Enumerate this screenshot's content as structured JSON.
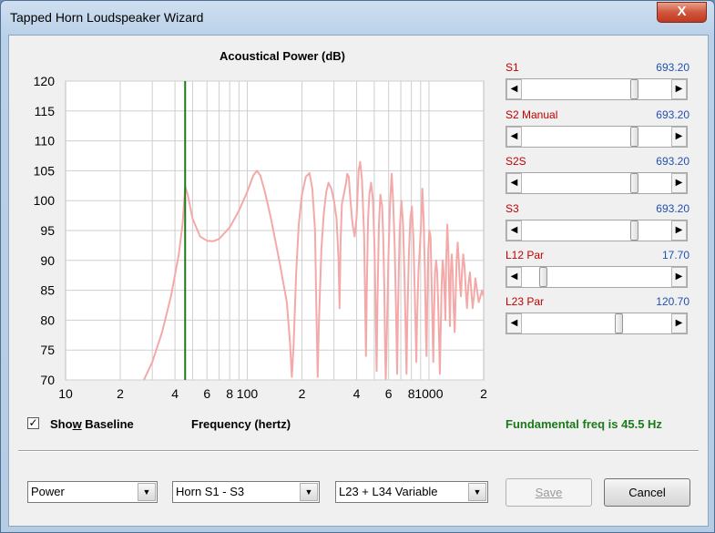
{
  "window": {
    "title": "Tapped Horn Loudspeaker Wizard",
    "close_glyph": "X"
  },
  "chart_data": {
    "type": "line",
    "title": "Acoustical Power (dB)",
    "xlabel": "Frequency (hertz)",
    "ylabel": "",
    "x_scale": "log",
    "xlim": [
      10,
      2000
    ],
    "ylim": [
      70,
      120
    ],
    "grid": true,
    "y_ticks": [
      "120",
      "115",
      "110",
      "105",
      "100",
      "95",
      "90",
      "85",
      "80",
      "75",
      "70"
    ],
    "x_ticks": [
      {
        "value": 10,
        "label": "10"
      },
      {
        "value": 20,
        "label": "2"
      },
      {
        "value": 40,
        "label": "4"
      },
      {
        "value": 60,
        "label": "6"
      },
      {
        "value": 80,
        "label": "8"
      },
      {
        "value": 100,
        "label": "100"
      },
      {
        "value": 200,
        "label": "2"
      },
      {
        "value": 400,
        "label": "4"
      },
      {
        "value": 600,
        "label": "6"
      },
      {
        "value": 800,
        "label": "8"
      },
      {
        "value": 1000,
        "label": "1000"
      },
      {
        "value": 2000,
        "label": "2"
      }
    ],
    "marker_x": 45.5,
    "marker_color": "#1a7a1a",
    "series_color": "#f4a9a9",
    "series": [
      {
        "points": [
          [
            27,
            70
          ],
          [
            30,
            73
          ],
          [
            34,
            78
          ],
          [
            38,
            84
          ],
          [
            42,
            91
          ],
          [
            44,
            96
          ],
          [
            45.5,
            102.3
          ],
          [
            47,
            101
          ],
          [
            50,
            97
          ],
          [
            55,
            94
          ],
          [
            60,
            93.3
          ],
          [
            65,
            93.2
          ],
          [
            70,
            93.6
          ],
          [
            80,
            95.5
          ],
          [
            90,
            98.3
          ],
          [
            100,
            101.5
          ],
          [
            108,
            104.2
          ],
          [
            113,
            105
          ],
          [
            118,
            104.2
          ],
          [
            125,
            101.5
          ],
          [
            135,
            97
          ],
          [
            150,
            90
          ],
          [
            165,
            83
          ],
          [
            172,
            76
          ],
          [
            176,
            70.5
          ],
          [
            180,
            76
          ],
          [
            186,
            88
          ],
          [
            192,
            96
          ],
          [
            200,
            101
          ],
          [
            210,
            104
          ],
          [
            220,
            104.6
          ],
          [
            228,
            102
          ],
          [
            236,
            95
          ],
          [
            240,
            82
          ],
          [
            244,
            70.5
          ],
          [
            248,
            80
          ],
          [
            256,
            92
          ],
          [
            264,
            98
          ],
          [
            272,
            101.5
          ],
          [
            280,
            103
          ],
          [
            290,
            102
          ],
          [
            300,
            100
          ],
          [
            310,
            97
          ],
          [
            318,
            90
          ],
          [
            322,
            82
          ],
          [
            326,
            93
          ],
          [
            332,
            99.5
          ],
          [
            340,
            101
          ],
          [
            350,
            103
          ],
          [
            355,
            104.5
          ],
          [
            362,
            104
          ],
          [
            370,
            100
          ],
          [
            380,
            96
          ],
          [
            390,
            94
          ],
          [
            400,
            97.5
          ],
          [
            410,
            105
          ],
          [
            418,
            106.5
          ],
          [
            428,
            103.5
          ],
          [
            440,
            94
          ],
          [
            446,
            82
          ],
          [
            450,
            74
          ],
          [
            455,
            85
          ],
          [
            462,
            97
          ],
          [
            470,
            101
          ],
          [
            480,
            103
          ],
          [
            492,
            100
          ],
          [
            502,
            92
          ],
          [
            510,
            80
          ],
          [
            515,
            71.5
          ],
          [
            520,
            82
          ],
          [
            530,
            96
          ],
          [
            540,
            101
          ],
          [
            553,
            99
          ],
          [
            560,
            94
          ],
          [
            568,
            85
          ],
          [
            573,
            76
          ],
          [
            578,
            70
          ],
          [
            585,
            76
          ],
          [
            598,
            90
          ],
          [
            610,
            99
          ],
          [
            623,
            104.5
          ],
          [
            635,
            100
          ],
          [
            648,
            92
          ],
          [
            660,
            80
          ],
          [
            668,
            71
          ],
          [
            676,
            82
          ],
          [
            690,
            95
          ],
          [
            705,
            100
          ],
          [
            720,
            96
          ],
          [
            735,
            86
          ],
          [
            745,
            77
          ],
          [
            752,
            71
          ],
          [
            760,
            80
          ],
          [
            775,
            91
          ],
          [
            790,
            97
          ],
          [
            805,
            99
          ],
          [
            820,
            94
          ],
          [
            835,
            85
          ],
          [
            845,
            78
          ],
          [
            852,
            73
          ],
          [
            860,
            80
          ],
          [
            875,
            88
          ],
          [
            890,
            92
          ],
          [
            905,
            96
          ],
          [
            920,
            102
          ],
          [
            935,
            97
          ],
          [
            950,
            88
          ],
          [
            962,
            78
          ],
          [
            970,
            74
          ],
          [
            978,
            82
          ],
          [
            992,
            92
          ],
          [
            1005,
            95
          ],
          [
            1020,
            94
          ],
          [
            1035,
            86
          ],
          [
            1048,
            78
          ],
          [
            1056,
            73
          ],
          [
            1065,
            80
          ],
          [
            1080,
            88
          ],
          [
            1095,
            90
          ],
          [
            1110,
            88
          ],
          [
            1125,
            82
          ],
          [
            1138,
            76
          ],
          [
            1148,
            71
          ],
          [
            1160,
            78
          ],
          [
            1175,
            86
          ],
          [
            1190,
            90
          ],
          [
            1205,
            88
          ],
          [
            1220,
            84
          ],
          [
            1232,
            80
          ],
          [
            1245,
            90
          ],
          [
            1262,
            96
          ],
          [
            1278,
            92
          ],
          [
            1292,
            85
          ],
          [
            1305,
            79
          ],
          [
            1318,
            88
          ],
          [
            1335,
            91
          ],
          [
            1350,
            88
          ],
          [
            1368,
            82
          ],
          [
            1385,
            78
          ],
          [
            1400,
            83
          ],
          [
            1420,
            90
          ],
          [
            1440,
            93
          ],
          [
            1460,
            90
          ],
          [
            1480,
            86
          ],
          [
            1500,
            84
          ],
          [
            1520,
            88
          ],
          [
            1545,
            91
          ],
          [
            1570,
            89
          ],
          [
            1595,
            85
          ],
          [
            1620,
            82
          ],
          [
            1650,
            86
          ],
          [
            1680,
            88
          ],
          [
            1710,
            85
          ],
          [
            1740,
            82
          ],
          [
            1770,
            84
          ],
          [
            1800,
            87
          ],
          [
            1840,
            85
          ],
          [
            1880,
            83
          ],
          [
            1920,
            84
          ],
          [
            1960,
            85
          ],
          [
            2000,
            84
          ]
        ]
      }
    ]
  },
  "sliders": [
    {
      "label": "S1",
      "value": "693.20",
      "fraction": 0.77
    },
    {
      "label": "S2  Manual",
      "value": "693.20",
      "fraction": 0.77
    },
    {
      "label": "S2S",
      "value": "693.20",
      "fraction": 0.77
    },
    {
      "label": "S3",
      "value": "693.20",
      "fraction": 0.77
    },
    {
      "label": "L12  Par",
      "value": "17.70",
      "fraction": 0.12
    },
    {
      "label": "L23  Par",
      "value": "120.70",
      "fraction": 0.66
    }
  ],
  "show_baseline": {
    "label_pre": "Sho",
    "label_underline": "w",
    "label_post": " Baseline",
    "checked": true,
    "check_glyph": "✓"
  },
  "fundamental": "Fundamental freq is 45.5 Hz",
  "dropdowns": [
    {
      "value": "Power"
    },
    {
      "value": "Horn S1 - S3"
    },
    {
      "value": "L23 + L34 Variable"
    }
  ],
  "buttons": {
    "save": "Save",
    "cancel": "Cancel",
    "dd_glyph": "▼",
    "left_glyph": "◀",
    "right_glyph": "▶"
  }
}
